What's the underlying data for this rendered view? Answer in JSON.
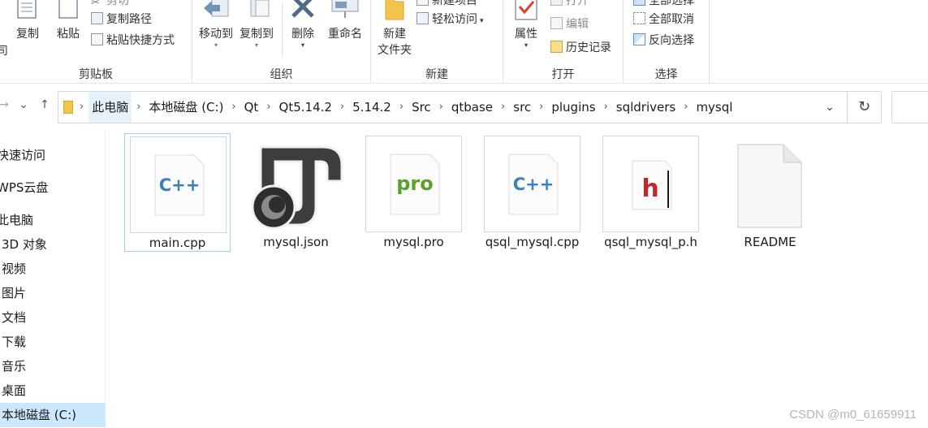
{
  "ribbon": {
    "clipboard": {
      "label": "剪贴板",
      "copy": "复制",
      "paste": "粘贴",
      "cut": "剪切",
      "copy_path": "复制路径",
      "paste_shortcut": "粘贴快捷方式",
      "left_fragment": "司"
    },
    "organize": {
      "label": "组织",
      "move_to": "移动到",
      "copy_to": "复制到",
      "delete": "删除",
      "rename": "重命名"
    },
    "new": {
      "label": "新建",
      "new_folder_line1": "新建",
      "new_folder_line2": "文件夹",
      "new_item": "新建项目",
      "easy_access": "轻松访问"
    },
    "open": {
      "label": "打开",
      "properties": "属性",
      "open_btn": "打开",
      "edit": "编辑",
      "history": "历史记录"
    },
    "select": {
      "label": "选择",
      "select_all": "全部选择",
      "select_none": "全部取消",
      "invert": "反向选择"
    }
  },
  "nav": {
    "breadcrumbs": [
      "此电脑",
      "本地磁盘 (C:)",
      "Qt",
      "Qt5.14.2",
      "5.14.2",
      "Src",
      "qtbase",
      "src",
      "plugins",
      "sqldrivers",
      "mysql"
    ]
  },
  "sidebar": {
    "items": [
      "快速访问",
      "WPS云盘",
      "此电脑",
      "3D 对象",
      "视频",
      "图片",
      "文档",
      "下载",
      "音乐",
      "桌面",
      "本地磁盘 (C:)"
    ]
  },
  "files": [
    {
      "name": "main.cpp",
      "icon": "cpp-file-icon",
      "badge": "C++"
    },
    {
      "name": "mysql.json",
      "icon": "json-file-icon",
      "badge": ""
    },
    {
      "name": "mysql.pro",
      "icon": "pro-file-icon",
      "badge": "pro"
    },
    {
      "name": "qsql_mysql.cpp",
      "icon": "cpp-file-icon",
      "badge": "C++"
    },
    {
      "name": "qsql_mysql_p.h",
      "icon": "header-file-icon",
      "badge": "h"
    },
    {
      "name": "README",
      "icon": "blank-file-icon",
      "badge": ""
    }
  ],
  "watermark": "CSDN @m0_61659911",
  "colors": {
    "selection": "#cce8ff",
    "tile_selection_border": "#99d1ff",
    "cpp_blue": "#3a7fc1",
    "pro_green": "#5aa02c",
    "h_red": "#c0282e"
  }
}
